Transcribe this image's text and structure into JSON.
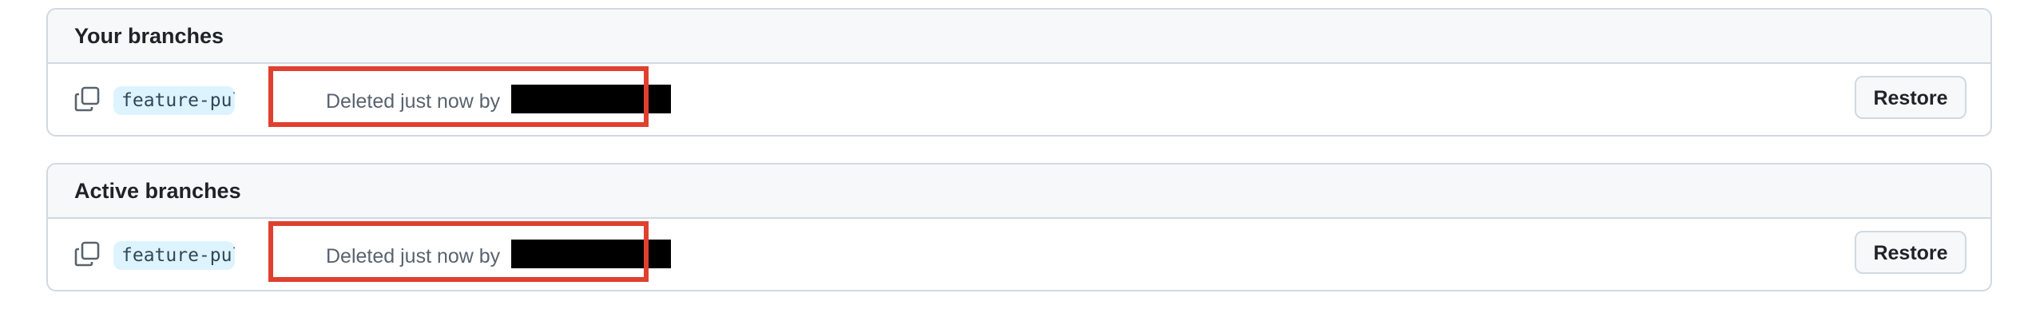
{
  "sections": [
    {
      "title": "Your branches",
      "branch": {
        "name": "feature-pull_r…",
        "status": "Deleted just now by",
        "action_label": "Restore"
      }
    },
    {
      "title": "Active branches",
      "branch": {
        "name": "feature-pull_r…",
        "status": "Deleted just now by",
        "action_label": "Restore"
      }
    }
  ],
  "icons": {
    "copy": "copy-icon"
  },
  "colors": {
    "highlight": "#e0402f",
    "branch_pill_bg": "#ddf4ff",
    "redaction": "#000000"
  }
}
